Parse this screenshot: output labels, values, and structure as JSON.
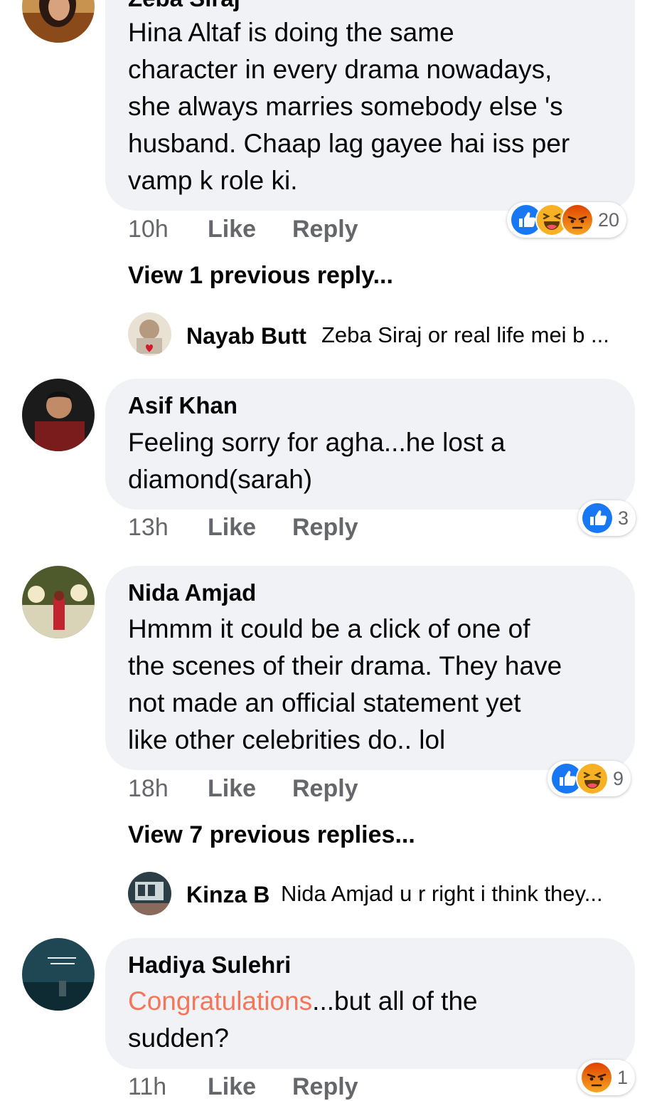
{
  "colors": {
    "bubble_bg": "#f0f2f5",
    "meta_text": "#65676b",
    "like_blue": "#1877f2",
    "haha_yellow": "#f7b125",
    "angry_orange": "#e9710f",
    "highlight": "#f3765a"
  },
  "comments": [
    {
      "author": "Zeba Siraj",
      "lines": [
        "Hina Altaf is doing the same",
        "character in every drama nowadays,",
        "she always marries somebody else 's",
        "husband. Chaap lag gayee hai iss per",
        "vamp k role ki."
      ],
      "time": "10h",
      "like": "Like",
      "reply": "Reply",
      "reaction_icons": [
        "like-icon",
        "haha-icon",
        "angry-icon"
      ],
      "reaction_count": "20",
      "view_replies": "View 1 previous reply...",
      "reply_preview": {
        "author": "Nayab Butt",
        "text": "Zeba Siraj or real life mei b ..."
      }
    },
    {
      "author": "Asif Khan",
      "lines": [
        "Feeling sorry for agha...he lost a",
        "diamond(sarah)"
      ],
      "time": "13h",
      "like": "Like",
      "reply": "Reply",
      "reaction_icons": [
        "like-icon"
      ],
      "reaction_count": "3"
    },
    {
      "author": "Nida Amjad",
      "lines": [
        "Hmmm it could be a click of one of",
        "the scenes of their drama. They have",
        "not made an official statement yet",
        "like other celebrities do.. lol"
      ],
      "time": "18h",
      "like": "Like",
      "reply": "Reply",
      "reaction_icons": [
        "like-icon",
        "haha-icon"
      ],
      "reaction_count": "9",
      "view_replies": "View 7 previous replies...",
      "reply_preview": {
        "author": "Kinza B",
        "text": "Nida Amjad u r right i think they..."
      }
    },
    {
      "author": "Hadiya Sulehri",
      "highlight": "Congratulations",
      "line1_rest": "...but all of the",
      "line2": "sudden?",
      "time": "11h",
      "like": "Like",
      "reply": "Reply",
      "reaction_icons": [
        "angry-icon"
      ],
      "reaction_count": "1"
    }
  ]
}
